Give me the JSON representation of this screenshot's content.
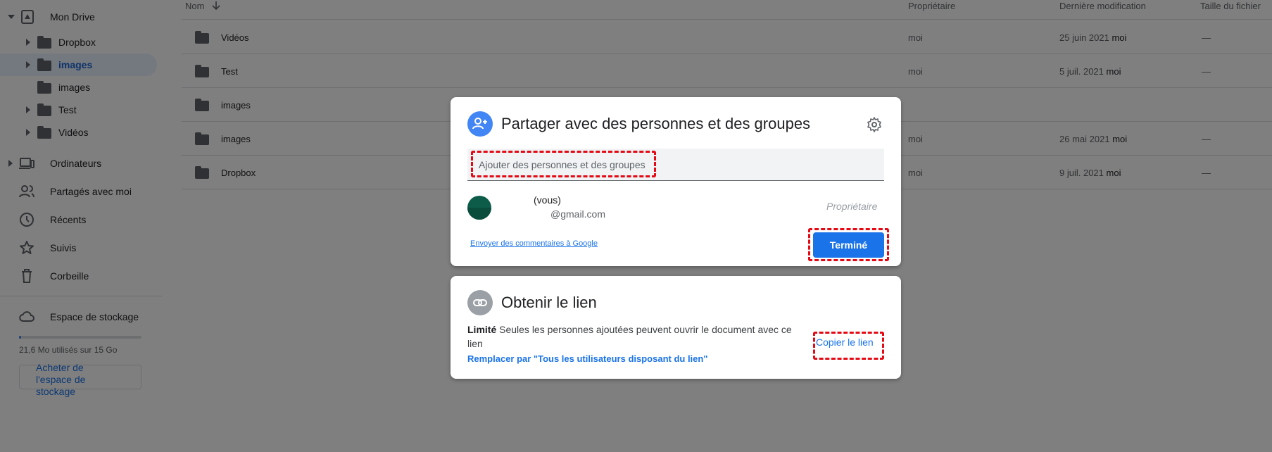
{
  "sidebar": {
    "my_drive": "Mon Drive",
    "tree": [
      {
        "label": "Dropbox"
      },
      {
        "label": "images"
      },
      {
        "label": "images"
      },
      {
        "label": "Test"
      },
      {
        "label": "Vidéos"
      }
    ],
    "nav": [
      {
        "label": "Ordinateurs",
        "icon": "computers-icon"
      },
      {
        "label": "Partagés avec moi",
        "icon": "shared-icon"
      },
      {
        "label": "Récents",
        "icon": "clock-icon"
      },
      {
        "label": "Suivis",
        "icon": "star-icon"
      },
      {
        "label": "Corbeille",
        "icon": "trash-icon"
      }
    ],
    "storage_label": "Espace de stockage",
    "storage_used_text": "21,6 Mo utilisés sur 15 Go",
    "storage_fraction": 0.0014,
    "buy_storage": "Acheter de l'espace de stockage"
  },
  "list": {
    "columns": {
      "name": "Nom",
      "owner": "Propriétaire",
      "modified": "Dernière modification",
      "size": "Taille du fichier"
    },
    "rows": [
      {
        "name": "Vidéos",
        "owner": "moi",
        "date": "25 juin 2021",
        "date_by": "moi",
        "size": "—"
      },
      {
        "name": "Test",
        "owner": "moi",
        "date": "5 juil. 2021",
        "date_by": "moi",
        "size": "—"
      },
      {
        "name": "images",
        "owner": "",
        "date": "",
        "date_by": "",
        "size": ""
      },
      {
        "name": "images",
        "owner": "moi",
        "date": "26 mai 2021",
        "date_by": "moi",
        "size": "—"
      },
      {
        "name": "Dropbox",
        "owner": "moi",
        "date": "9 juil. 2021",
        "date_by": "moi",
        "size": "—"
      }
    ]
  },
  "share_dialog": {
    "title": "Partager avec des personnes et des groupes",
    "add_placeholder": "Ajouter des personnes et des groupes",
    "person_name_suffix": "(vous)",
    "person_email": "@gmail.com",
    "person_role": "Propriétaire",
    "feedback_link": "Envoyer des commentaires à Google",
    "done_button": "Terminé"
  },
  "link_dialog": {
    "title": "Obtenir le lien",
    "access_level": "Limité",
    "access_description": "Seules les personnes ajoutées peuvent ouvrir le document avec ce lien",
    "change_link": "Remplacer par \"Tous les utilisateurs disposant du lien\"",
    "copy_link": "Copier le lien"
  },
  "colors": {
    "accent": "#1a73e8",
    "highlight_dash": "#e50914",
    "selected_bg": "#e8f0fe"
  }
}
